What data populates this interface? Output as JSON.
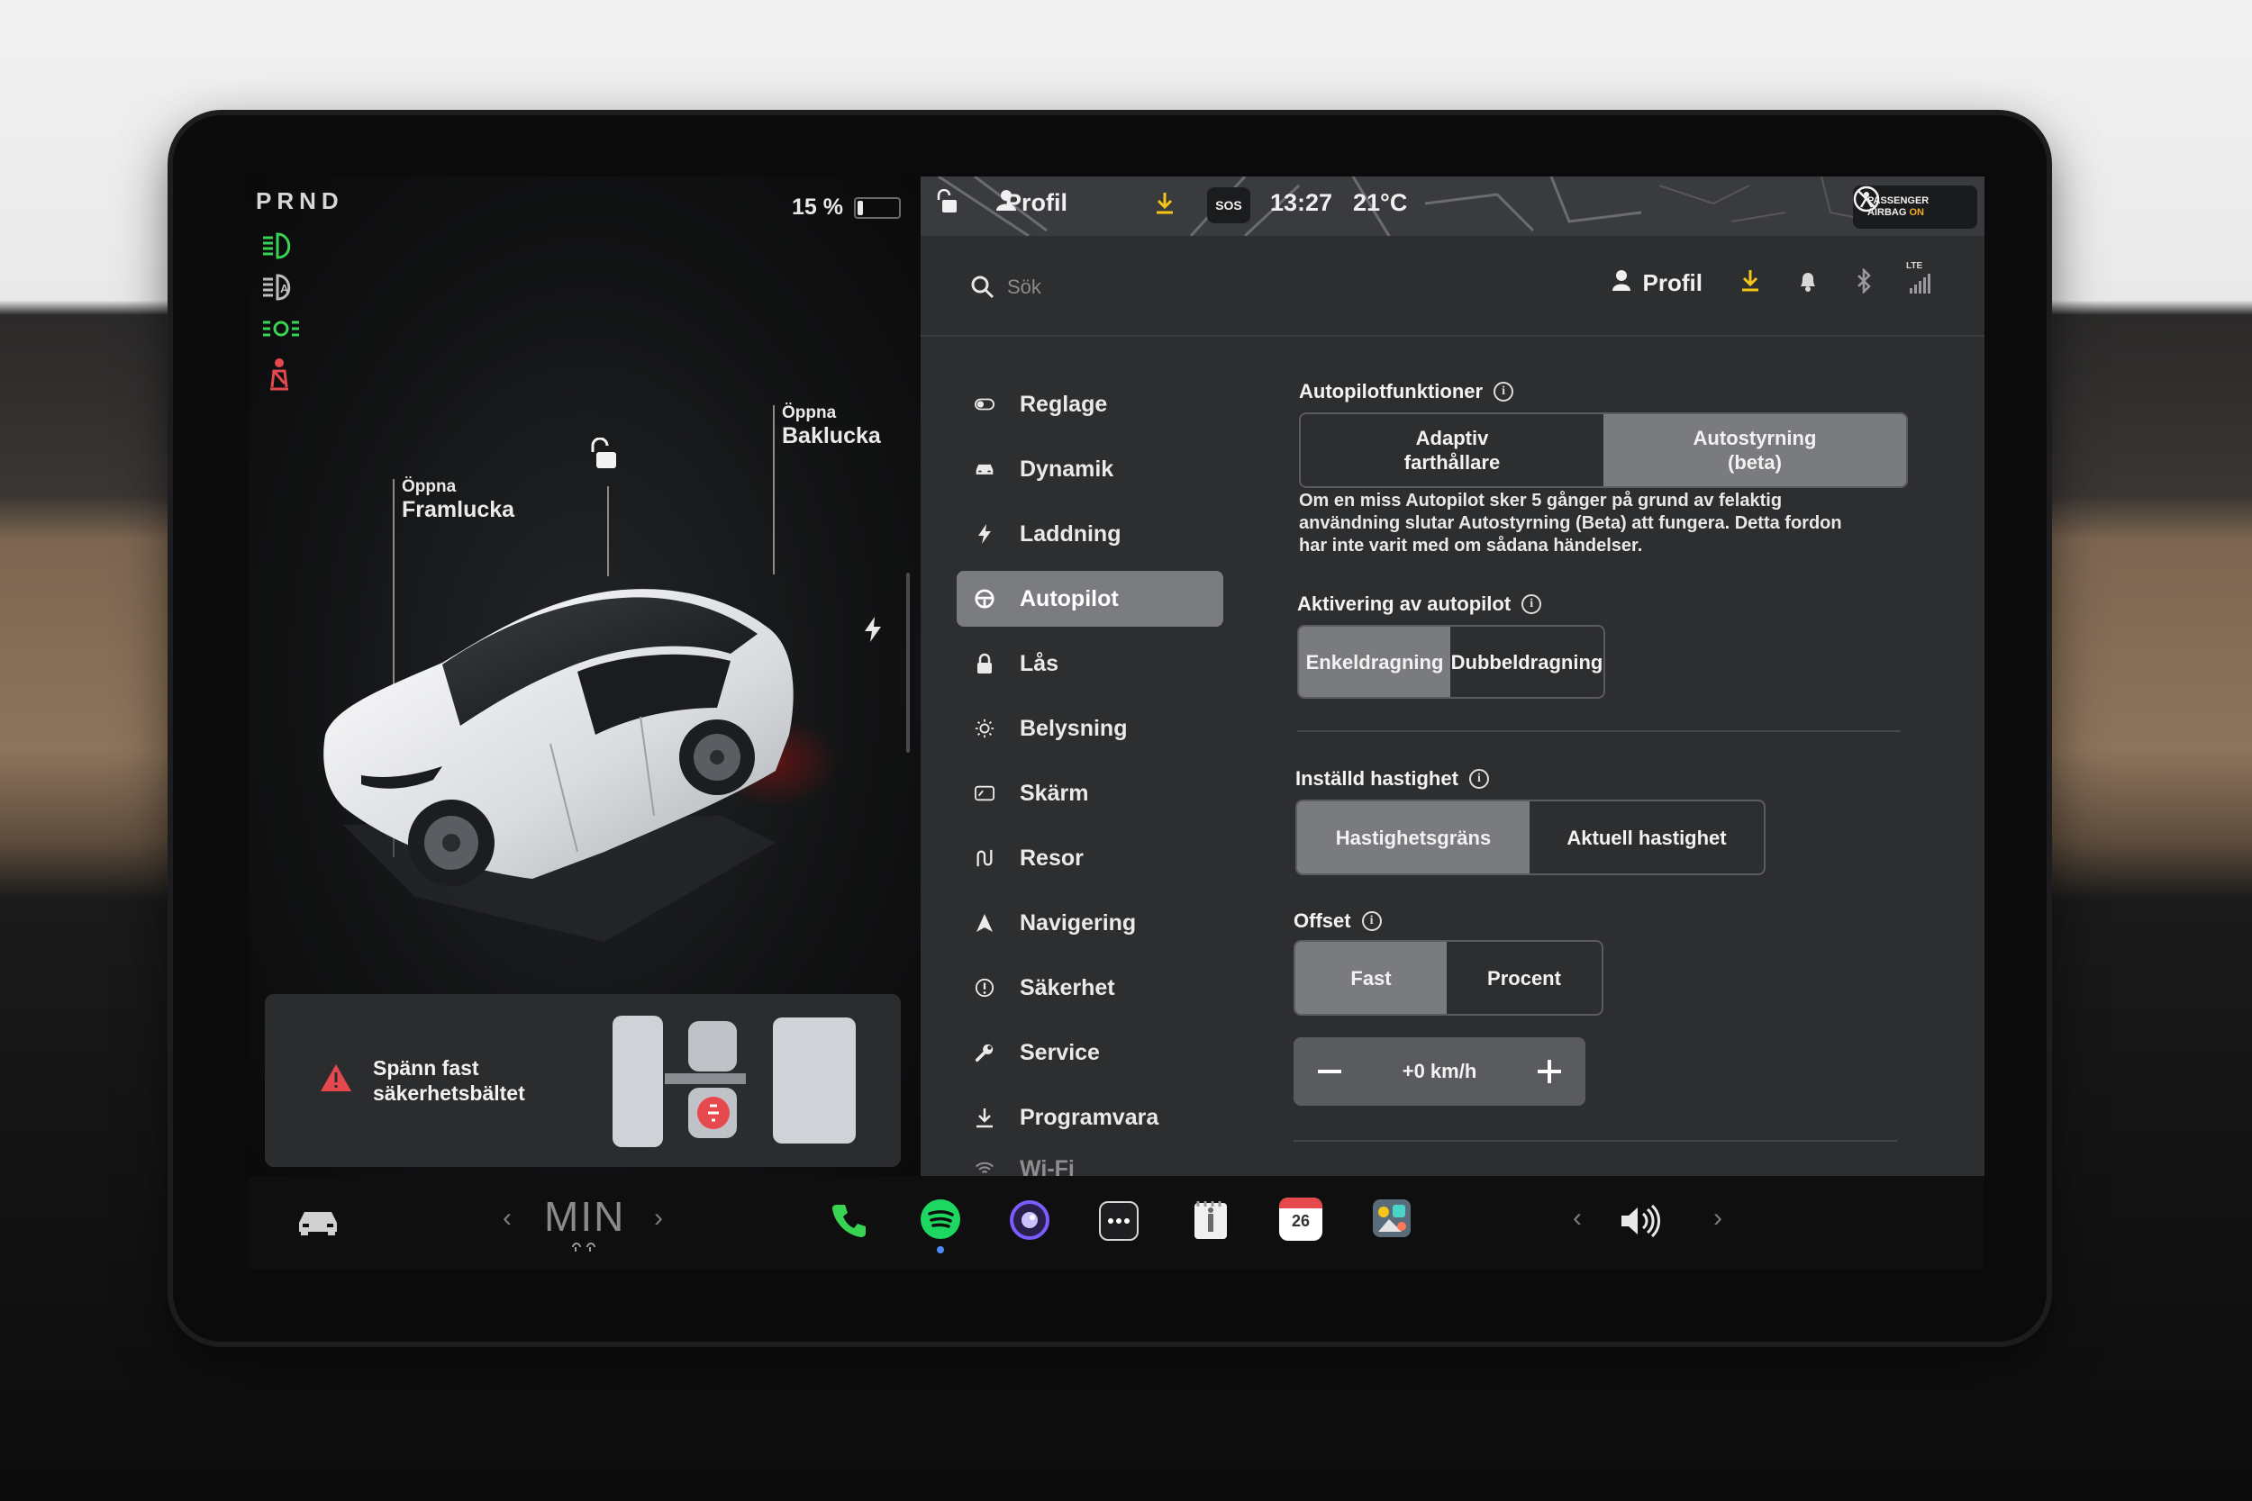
{
  "gear": "PRND",
  "battery": {
    "percent": "15 %"
  },
  "car": {
    "frunk": {
      "small": "Öppna",
      "big": "Framlucka"
    },
    "trunk": {
      "small": "Öppna",
      "big": "Baklucka"
    }
  },
  "alert": {
    "text_line1": "Spänn fast",
    "text_line2": "säkerhetsbältet"
  },
  "status": {
    "profile": "Profil",
    "sos": "SOS",
    "time": "13:27",
    "temp": "21°C",
    "airbag_line1": "PASSENGER",
    "airbag_line2a": "AIRBAG ",
    "airbag_line2b": "ON",
    "lte": "LTE"
  },
  "topbar": {
    "search_placeholder": "Sök",
    "profile": "Profil"
  },
  "menu": [
    {
      "label": "Reglage",
      "icon": "toggle-icon"
    },
    {
      "label": "Dynamik",
      "icon": "car-icon"
    },
    {
      "label": "Laddning",
      "icon": "bolt-icon"
    },
    {
      "label": "Autopilot",
      "icon": "steering-wheel-icon",
      "active": true
    },
    {
      "label": "Lås",
      "icon": "lock-icon"
    },
    {
      "label": "Belysning",
      "icon": "sun-icon"
    },
    {
      "label": "Skärm",
      "icon": "display-icon"
    },
    {
      "label": "Resor",
      "icon": "trips-icon"
    },
    {
      "label": "Navigering",
      "icon": "navigation-icon"
    },
    {
      "label": "Säkerhet",
      "icon": "safety-icon"
    },
    {
      "label": "Service",
      "icon": "wrench-icon"
    },
    {
      "label": "Programvara",
      "icon": "download-icon"
    },
    {
      "label": "Wi-Fi",
      "icon": "wifi-icon"
    }
  ],
  "autopilot": {
    "features_title": "Autopilotfunktioner",
    "features_opt1_l1": "Adaptiv",
    "features_opt1_l2": "farthållare",
    "features_opt2_l1": "Autostyrning",
    "features_opt2_l2": "(beta)",
    "features_selected": "Autostyrning (beta)",
    "desc_l1": "Om en miss Autopilot sker 5 gånger på grund av felaktig",
    "desc_l2": "användning slutar Autostyrning (Beta) att fungera. Detta fordon",
    "desc_l3": "har inte varit med om sådana händelser.",
    "activation_title": "Aktivering av autopilot",
    "activation_opt1": "Enkeldragning",
    "activation_opt2": "Dubbeldragning",
    "activation_selected": "Enkeldragning",
    "speed_title": "Inställd hastighet",
    "speed_opt1": "Hastighetsgräns",
    "speed_opt2": "Aktuell hastighet",
    "speed_selected": "Hastighetsgräns",
    "offset_title": "Offset",
    "offset_opt1": "Fast",
    "offset_opt2": "Procent",
    "offset_selected": "Fast",
    "offset_value": "+0 km/h"
  },
  "dock": {
    "climate": "MIN",
    "calendar_day": "26"
  },
  "colors": {
    "accent_green": "#39d353",
    "seatbelt_red": "#e5484d",
    "download_yellow": "#f5c518",
    "selected_segment": "#7a7b7f"
  }
}
